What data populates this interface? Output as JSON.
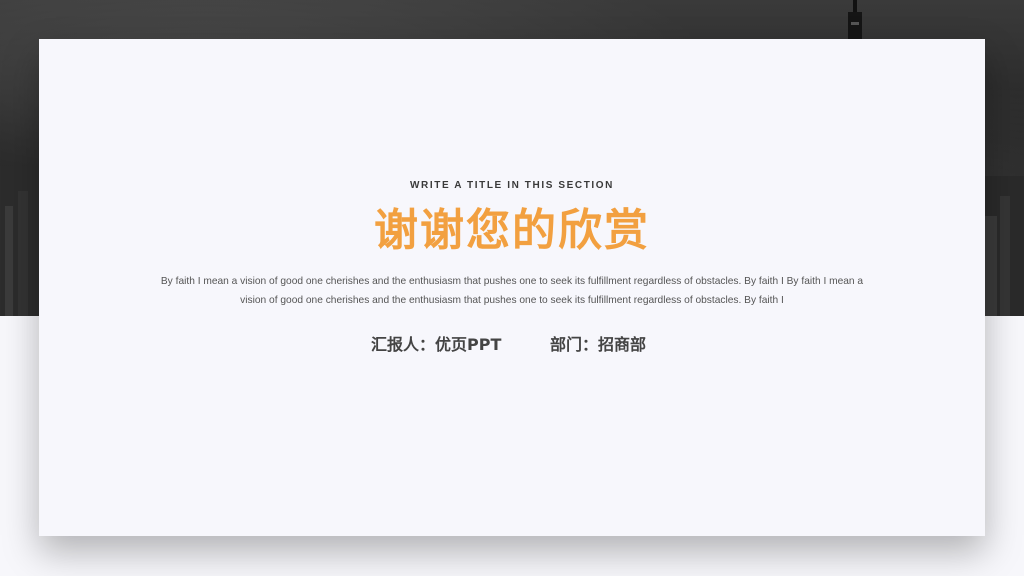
{
  "slide": {
    "subtitle": "WRITE A TITLE IN THIS SECTION",
    "title": "谢谢您的欣赏",
    "description": "By faith I mean a vision of good one cherishes and the enthusiasm that pushes one to seek its fulfillment regardless of obstacles. By faith I By faith I mean a vision of good one cherishes and the enthusiasm that pushes one to seek its fulfillment regardless of obstacles. By faith I",
    "reporter": "汇报人：优页PPT",
    "department": "部门：招商部"
  },
  "colors": {
    "title": "#f2a040",
    "card": "#f7f7fc",
    "text": "#555555"
  }
}
